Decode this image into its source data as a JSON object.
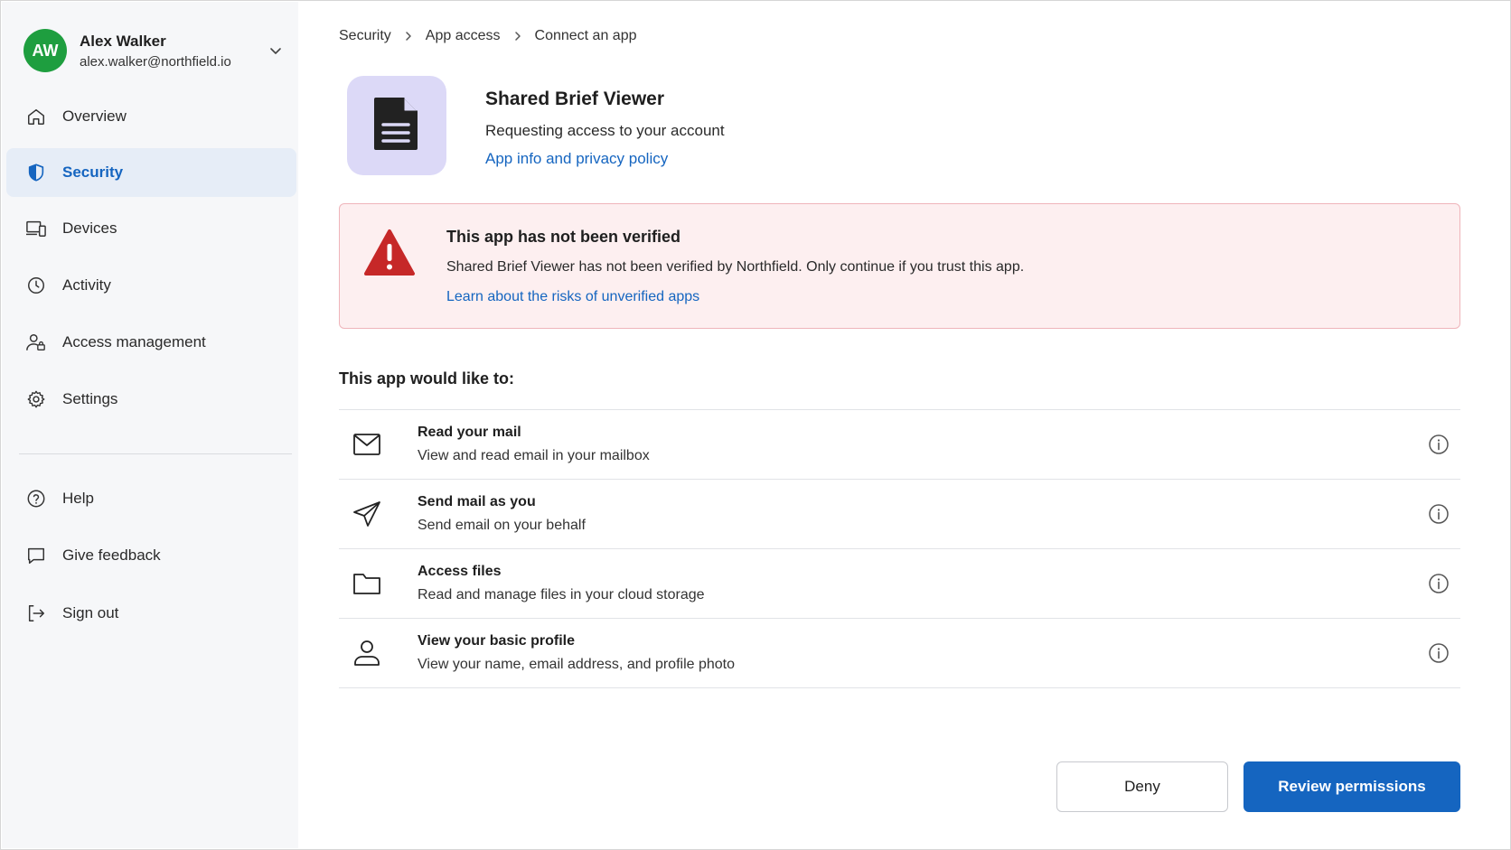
{
  "account": {
    "initials": "AW",
    "name": "Alex Walker",
    "email": "alex.walker@northfield.io",
    "avatar_color": "#1e9e3f"
  },
  "sidebar": {
    "items": [
      {
        "label": "Overview",
        "icon": "home-icon",
        "active": false
      },
      {
        "label": "Security",
        "icon": "shield-icon",
        "active": true
      },
      {
        "label": "Devices",
        "icon": "devices-icon",
        "active": false
      },
      {
        "label": "Activity",
        "icon": "clock-icon",
        "active": false
      },
      {
        "label": "Access management",
        "icon": "user-lock-icon",
        "active": false
      },
      {
        "label": "Settings",
        "icon": "gear-icon",
        "active": false
      }
    ],
    "secondary": [
      {
        "label": "Help",
        "icon": "help-circle-icon"
      },
      {
        "label": "Give feedback",
        "icon": "chat-bubble-icon"
      },
      {
        "label": "Sign out",
        "icon": "sign-out-icon"
      }
    ]
  },
  "breadcrumb": [
    "Security",
    "App access",
    "Connect an app"
  ],
  "app": {
    "name": "Shared Brief Viewer",
    "subtitle": "Requesting access to your account",
    "link": "App info and privacy policy",
    "icon": "document-icon",
    "tile_color": "#dcd9f7"
  },
  "alert": {
    "title": "This app has not been verified",
    "body": "Shared Brief Viewer has not been verified by Northfield. Only continue if you trust this app.",
    "link": "Learn about the risks of unverified apps",
    "icon": "warning-triangle-icon",
    "color": "#c62828"
  },
  "permissions": {
    "heading": "This app would like to:",
    "items": [
      {
        "title": "Read your mail",
        "desc": "View and read email in your mailbox",
        "icon": "envelope-icon"
      },
      {
        "title": "Send mail as you",
        "desc": "Send email on your behalf",
        "icon": "send-icon"
      },
      {
        "title": "Access files",
        "desc": "Read and manage files in your cloud storage",
        "icon": "folder-icon"
      },
      {
        "title": "View your basic profile",
        "desc": "View your name, email address, and profile photo",
        "icon": "person-icon"
      }
    ]
  },
  "actions": {
    "deny": "Deny",
    "review": "Review permissions",
    "accent": "#1565c0"
  }
}
